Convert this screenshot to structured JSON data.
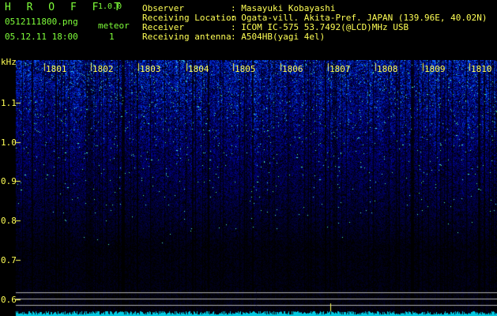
{
  "header": {
    "brand": "H R O F F T",
    "version": "1.0.0",
    "filename": "0512111800.png",
    "meteor_label": "meteor",
    "datetime": "05.12.11 18:00",
    "meteor_count": "1",
    "fields": [
      {
        "label": "Observer",
        "value": ": Masayuki Kobayashi"
      },
      {
        "label": "Receiving Location",
        "value": ": Ogata-vill. Akita-Pref. JAPAN (139.96E, 40.02N)"
      },
      {
        "label": "Receiver",
        "value": ": ICOM IC-575 53.7492(@LCD)MHz USB"
      },
      {
        "label": "Receiving antenna",
        "value": ": A504HB(yagi 4el)"
      }
    ]
  },
  "axis": {
    "unit": "kHz",
    "y_ticks": [
      "1.1",
      "1.0",
      "0.9",
      "0.8",
      "0.7",
      "0.6"
    ],
    "minute_marks": [
      "1801",
      "1802",
      "1803",
      "1804",
      "1805",
      "1806",
      "1807",
      "1808",
      "1809",
      "1810"
    ]
  },
  "colors": {
    "signal_blue": "#2a5cff",
    "noise_dark": "#000000",
    "text_yellow": "#ffff55",
    "text_green": "#7fff3a",
    "trace_cyan": "#00c8e0"
  }
}
